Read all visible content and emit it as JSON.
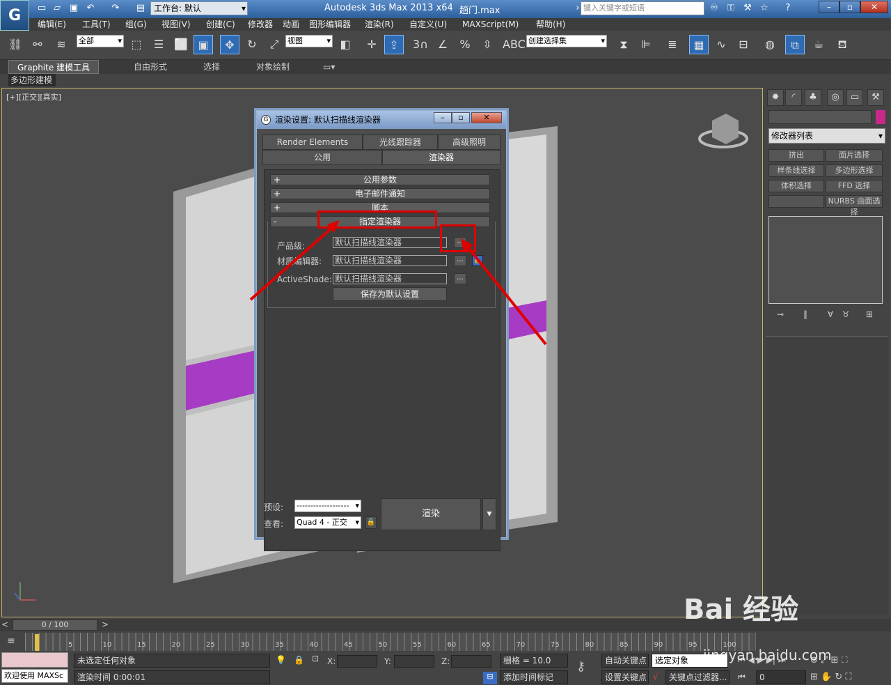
{
  "title_bar": {
    "workspace_label": "工作台: 默认",
    "app_title": "Autodesk 3ds Max  2013 x64",
    "file_name": "趟门.max",
    "search_placeholder": "键入关键字或短语"
  },
  "menu": [
    "编辑(E)",
    "工具(T)",
    "组(G)",
    "视图(V)",
    "创建(C)",
    "修改器",
    "动画",
    "图形编辑器",
    "渲染(R)",
    "自定义(U)",
    "MAXScript(M)",
    "帮助(H)"
  ],
  "toolbar": {
    "filter_value": "全部",
    "refcoord_value": "视图",
    "selection_set_value": "创建选择集"
  },
  "ribbon": {
    "tabs": [
      "Graphite 建模工具",
      "自由形式",
      "选择",
      "对象绘制"
    ],
    "sub_label": "多边形建模"
  },
  "viewport": {
    "label": "[+][正交][真实]"
  },
  "command_panel": {
    "modifier_list": "修改器列表",
    "buttons": [
      "挤出",
      "面片选择",
      "样条线选择",
      "多边形选择",
      "体积选择",
      "FFD 选择",
      "",
      "NURBS 曲面选择"
    ],
    "accent_color": "#c8288a"
  },
  "dialog": {
    "title": "渲染设置: 默认扫描线渲染器",
    "tabs_row1": [
      "Render Elements",
      "光线跟踪器",
      "高级照明"
    ],
    "tabs_row2": [
      "公用",
      "渲染器"
    ],
    "rollouts": [
      {
        "sign": "+",
        "label": "公用参数"
      },
      {
        "sign": "+",
        "label": "电子邮件通知"
      },
      {
        "sign": "+",
        "label": "脚本"
      },
      {
        "sign": "-",
        "label": "指定渲染器"
      }
    ],
    "fields": [
      {
        "label": "产品级:",
        "value": "默认扫描线渲染器"
      },
      {
        "label": "材质编辑器:",
        "value": "默认扫描线渲染器"
      },
      {
        "label": "ActiveShade:",
        "value": "默认扫描线渲染器"
      }
    ],
    "browse_label": "...",
    "save_default": "保存为默认设置",
    "preset_label": "预设:",
    "preset_value": "-------------------",
    "view_label": "查看:",
    "view_value": "Quad 4 - 正交",
    "render_button": "渲染"
  },
  "timeline": {
    "slider_label": "0 / 100",
    "ticks": [
      "5",
      "10",
      "15",
      "20",
      "25",
      "30",
      "35",
      "40",
      "45",
      "50",
      "55",
      "60",
      "65",
      "70",
      "75",
      "80",
      "85",
      "90",
      "95",
      "100"
    ]
  },
  "status": {
    "welcome": "欢迎使用 MAXSc",
    "selection_status": "未选定任何对象",
    "render_time": "渲染时间 0:00:01",
    "x_label": "X:",
    "y_label": "Y:",
    "z_label": "Z:",
    "grid": "栅格 = 10.0",
    "add_time_tag": "添加时间标记",
    "auto_key": "自动关键点",
    "set_key": "设置关键点",
    "key_filter_value": "选定对象",
    "key_filters": "关键点过滤器...",
    "frame_value": "0"
  },
  "watermark": {
    "brand": "Bai 经验",
    "url": "jingyan.baidu.com"
  }
}
